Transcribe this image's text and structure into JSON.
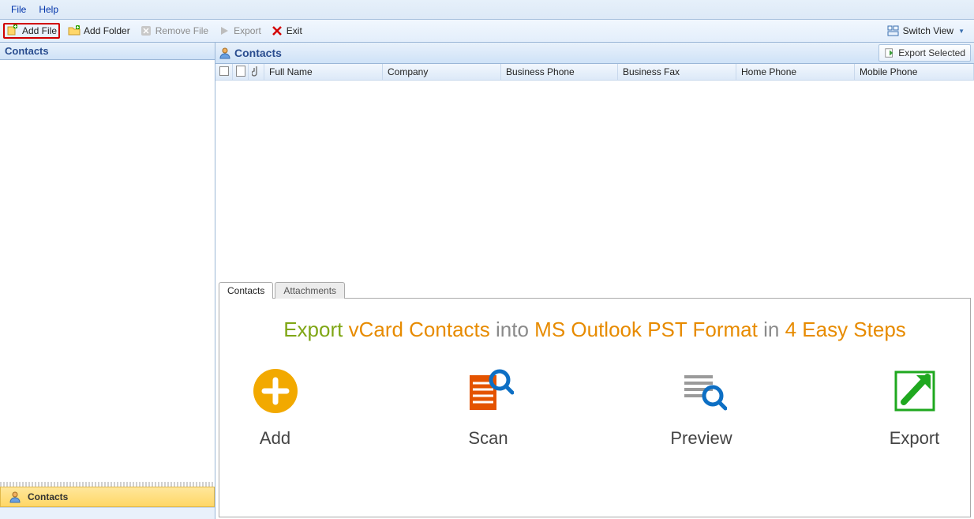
{
  "menu": {
    "file": "File",
    "help": "Help"
  },
  "toolbar": {
    "add_file": "Add File",
    "add_folder": "Add Folder",
    "remove_file": "Remove File",
    "export": "Export",
    "exit": "Exit",
    "switch_view": "Switch View"
  },
  "sidebar": {
    "header": "Contacts",
    "nav_contacts": "Contacts"
  },
  "panel": {
    "title": "Contacts",
    "export_selected": "Export Selected"
  },
  "grid": {
    "columns": [
      "Full Name",
      "Company",
      "Business Phone",
      "Business Fax",
      "Home Phone",
      "Mobile Phone"
    ]
  },
  "tabs": {
    "contacts": "Contacts",
    "attachments": "Attachments"
  },
  "promo": {
    "p1": "Export",
    "p2": "vCard Contacts",
    "p3": "into",
    "p4": "MS Outlook PST Format",
    "p5": "in",
    "p6": "4 Easy Steps"
  },
  "steps": {
    "add": "Add",
    "scan": "Scan",
    "preview": "Preview",
    "export": "Export"
  }
}
